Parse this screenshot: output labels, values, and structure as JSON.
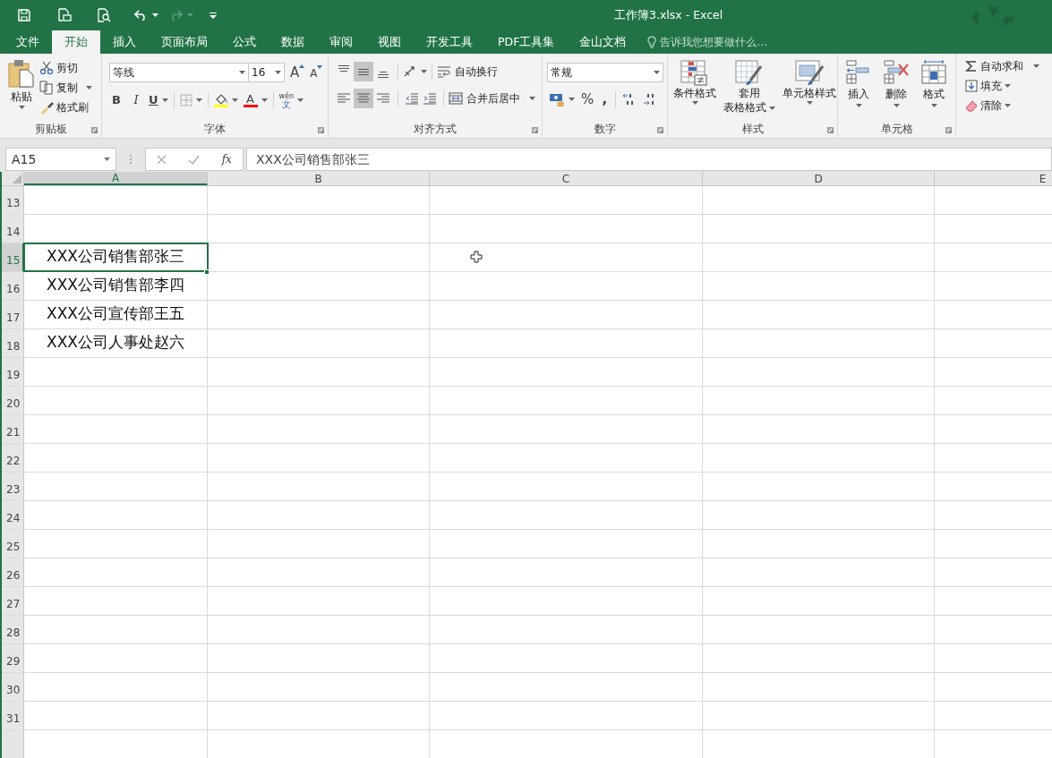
{
  "window": {
    "title": "工作簿3.xlsx - Excel"
  },
  "tabs": [
    {
      "label": "文件",
      "selected": false
    },
    {
      "label": "开始",
      "selected": true
    },
    {
      "label": "插入",
      "selected": false
    },
    {
      "label": "页面布局",
      "selected": false
    },
    {
      "label": "公式",
      "selected": false
    },
    {
      "label": "数据",
      "selected": false
    },
    {
      "label": "审阅",
      "selected": false
    },
    {
      "label": "视图",
      "selected": false
    },
    {
      "label": "开发工具",
      "selected": false
    },
    {
      "label": "PDF工具集",
      "selected": false
    },
    {
      "label": "金山文档",
      "selected": false
    }
  ],
  "tell_me": {
    "placeholder": "告诉我您想要做什么..."
  },
  "clipboard": {
    "label": "剪贴板",
    "paste": "粘贴",
    "cut": "剪切",
    "copy": "复制",
    "format_painter": "格式刷"
  },
  "font": {
    "label": "字体",
    "font_name": "等线",
    "font_size": "16",
    "grow": "A",
    "shrink": "A",
    "bold": "B",
    "italic": "I",
    "underline": "U",
    "font_color": "A",
    "phonetic_top": "wén",
    "phonetic_bottom": "文"
  },
  "alignment": {
    "label": "对齐方式",
    "vertical": [
      {
        "kind": "top",
        "selected": false
      },
      {
        "kind": "middle",
        "selected": true
      },
      {
        "kind": "bottom",
        "selected": false
      }
    ],
    "horizontal": [
      {
        "kind": "left",
        "selected": false
      },
      {
        "kind": "center",
        "selected": true
      },
      {
        "kind": "right",
        "selected": false
      }
    ],
    "wrap_text": "自动换行",
    "merge_center": "合并后居中"
  },
  "number": {
    "label": "数字",
    "format": "常规",
    "percent": "%",
    "comma": ","
  },
  "styles": {
    "label": "样式",
    "buttons": [
      {
        "kind": "conditional",
        "lines": [
          "条件格式"
        ]
      },
      {
        "kind": "table",
        "lines": [
          "套用",
          "表格格式"
        ]
      },
      {
        "kind": "cell",
        "lines": [
          "单元格样式"
        ]
      }
    ]
  },
  "cells": {
    "label": "单元格",
    "buttons": [
      {
        "kind": "insert",
        "label": "插入"
      },
      {
        "kind": "delete",
        "label": "删除"
      },
      {
        "kind": "format",
        "label": "格式"
      }
    ]
  },
  "editing": {
    "autosum": "自动求和",
    "fill": "填充",
    "clear": "清除"
  },
  "formula_bar": {
    "name_box": "A15",
    "function_label": "fx",
    "value": "XXX公司销售部张三"
  },
  "sheet": {
    "columns": [
      {
        "label": "A",
        "selected": true
      },
      {
        "label": "B",
        "selected": false
      },
      {
        "label": "C",
        "selected": false
      },
      {
        "label": "D",
        "selected": false
      },
      {
        "label": "E",
        "selected": false
      }
    ],
    "rows": [
      {
        "header": "13",
        "selected": false
      },
      {
        "header": "14",
        "selected": false
      },
      {
        "header": "15",
        "selected": true,
        "a": "XXX公司销售部张三"
      },
      {
        "header": "16",
        "selected": false,
        "a": "XXX公司销售部李四"
      },
      {
        "header": "17",
        "selected": false,
        "a": "XXX公司宣传部王五"
      },
      {
        "header": "18",
        "selected": false,
        "a": "XXX公司人事处赵六"
      },
      {
        "header": "19",
        "selected": false
      },
      {
        "header": "20",
        "selected": false
      },
      {
        "header": "21",
        "selected": false
      },
      {
        "header": "22",
        "selected": false
      },
      {
        "header": "23",
        "selected": false
      },
      {
        "header": "24",
        "selected": false
      },
      {
        "header": "25",
        "selected": false
      },
      {
        "header": "26",
        "selected": false
      },
      {
        "header": "27",
        "selected": false
      },
      {
        "header": "28",
        "selected": false
      },
      {
        "header": "29",
        "selected": false
      },
      {
        "header": "30",
        "selected": false
      },
      {
        "header": "31",
        "selected": false
      }
    ]
  }
}
